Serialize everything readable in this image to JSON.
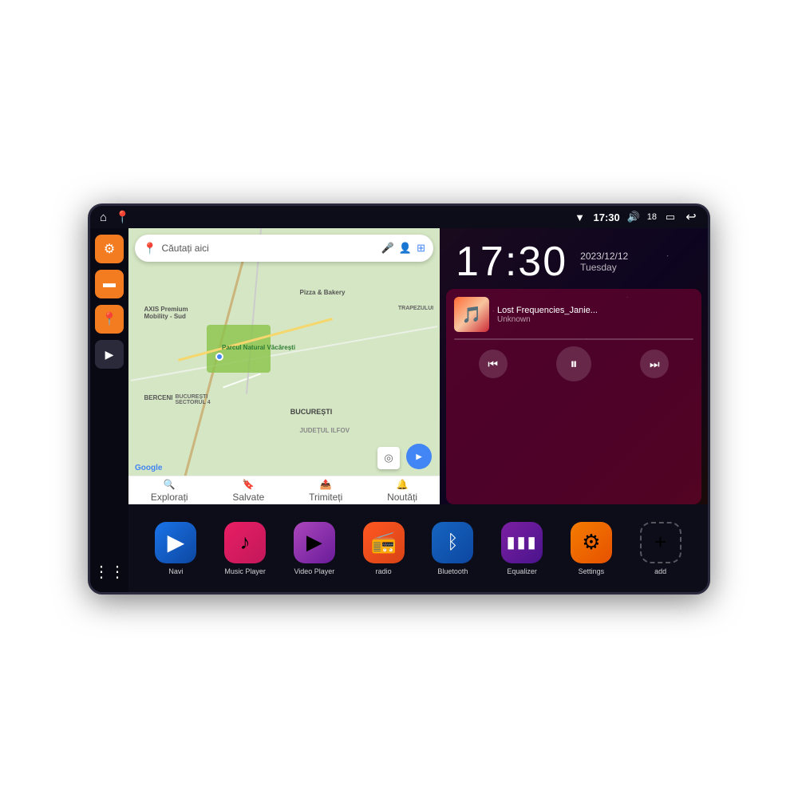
{
  "device": {
    "screen_bg": "#0d0d1a"
  },
  "status_bar": {
    "wifi_icon": "▼",
    "time": "17:30",
    "volume_icon": "🔊",
    "battery_level": "18",
    "battery_icon": "🔋",
    "back_icon": "↩",
    "home_icon": "⌂",
    "maps_icon": "📍"
  },
  "sidebar": {
    "settings_icon": "⚙",
    "files_icon": "📁",
    "maps_icon": "📍",
    "navi_icon": "▶",
    "grid_icon": "⋮⋮"
  },
  "map": {
    "search_placeholder": "Căutați aici",
    "locations": [
      "AXIS Premium Mobility - Sud",
      "Parcul Natural Văcărești",
      "Pizza & Bakery",
      "BERCENI",
      "BUCUREȘTI SECTORUL 4",
      "BUCUREȘTI",
      "JUDEȚUL ILFOV",
      "TRAPEZULUI"
    ],
    "bottom_items": [
      "Explorați",
      "Salvate",
      "Trimiteți",
      "Noutăți"
    ],
    "bottom_icons": [
      "🔍",
      "🔖",
      "📤",
      "🔔"
    ],
    "google_label": "Google"
  },
  "clock": {
    "time": "17:30",
    "date": "2023/12/12",
    "day": "Tuesday"
  },
  "music": {
    "title": "Lost Frequencies_Janie...",
    "artist": "Unknown",
    "prev_icon": "⏮",
    "pause_icon": "⏸",
    "next_icon": "⏭"
  },
  "apps": [
    {
      "id": "navi",
      "label": "Navi",
      "icon": "➤",
      "class": "navi"
    },
    {
      "id": "music-player",
      "label": "Music Player",
      "icon": "♪",
      "class": "music"
    },
    {
      "id": "video-player",
      "label": "Video Player",
      "icon": "▶",
      "class": "video"
    },
    {
      "id": "radio",
      "label": "radio",
      "icon": "📻",
      "class": "radio"
    },
    {
      "id": "bluetooth",
      "label": "Bluetooth",
      "icon": "⚡",
      "class": "bluetooth"
    },
    {
      "id": "equalizer",
      "label": "Equalizer",
      "icon": "🎚",
      "class": "equalizer"
    },
    {
      "id": "settings",
      "label": "Settings",
      "icon": "⚙",
      "class": "settings"
    },
    {
      "id": "add",
      "label": "add",
      "icon": "+",
      "class": "add"
    }
  ]
}
